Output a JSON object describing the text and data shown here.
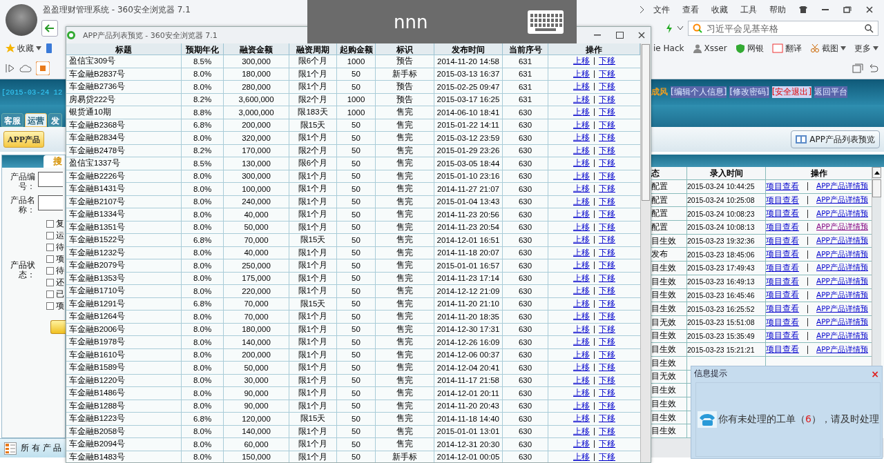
{
  "browser": {
    "title": "盈盈理财管理系统 - 360安全浏览器 7.1",
    "menu": [
      "文件",
      "查看",
      "收藏",
      "工具",
      "帮助"
    ],
    "search": {
      "placeholder": "习近平会见基辛格"
    },
    "bookmarks_left": [
      {
        "label": "收藏"
      }
    ],
    "bookmarks_right": [
      {
        "label": "ie Hack",
        "kind": "plain"
      },
      {
        "label": "Xsser",
        "kind": "person"
      },
      {
        "label": "网银",
        "kind": "shield"
      },
      {
        "label": "翻译",
        "kind": "translate"
      },
      {
        "label": "截图",
        "kind": "scissors"
      },
      {
        "label": "更多",
        "kind": "more"
      }
    ]
  },
  "overlay": {
    "text": "nnn"
  },
  "page": {
    "date": "[2015-03-24 12",
    "user_name": "成风",
    "user_links": [
      {
        "label": "[编辑个人信息]",
        "kind": "normal"
      },
      {
        "label": "[修改密码]",
        "kind": "normal"
      },
      {
        "label": "[安全退出]",
        "kind": "danger"
      },
      {
        "label": "返回平台",
        "kind": "plain"
      }
    ],
    "tabs": [
      {
        "label": "客服",
        "selected": false
      },
      {
        "label": "运营",
        "selected": true
      },
      {
        "label": "发",
        "selected": false
      }
    ],
    "product_button": "APP产品",
    "preview_button": "APP产品列表预览",
    "search_tab": "搜",
    "form": {
      "fields": [
        {
          "label": "产品编号："
        },
        {
          "label": "产品名称："
        }
      ],
      "status_label": "产品状态：",
      "options": [
        {
          "label": "复",
          "checked": false
        },
        {
          "label": "运",
          "checked": false
        },
        {
          "label": "待",
          "checked": false
        },
        {
          "label": "项",
          "checked": false
        },
        {
          "label": "待",
          "checked": false
        },
        {
          "label": "还",
          "checked": false
        },
        {
          "label": "已",
          "checked": false
        },
        {
          "label": "项",
          "checked": false
        }
      ]
    },
    "all_products": "所 有 产 品",
    "table": {
      "columns": [
        "态",
        "录入时间",
        "操作"
      ],
      "rows": [
        {
          "status": "配置",
          "time": "2015-03-24 10:44:25",
          "view": "项目查看",
          "preview": "APP产品详情预",
          "visited": false
        },
        {
          "status": "配置",
          "time": "2015-03-24 10:25:08",
          "view": "项目查看",
          "preview": "APP产品详情预",
          "visited": false
        },
        {
          "status": "配置",
          "time": "2015-03-24 10:08:23",
          "view": "项目查看",
          "preview": "APP产品详情预",
          "visited": false
        },
        {
          "status": "配置",
          "time": "2015-03-24 10:08:13",
          "view": "项目查看",
          "preview": "APP产品详情预",
          "visited": true
        },
        {
          "status": "目生效",
          "time": "2015-03-23 19:32:36",
          "view": "项目查看",
          "preview": "APP产品详情预",
          "visited": false
        },
        {
          "status": "发布",
          "time": "2015-03-23 18:45:06",
          "view": "项目查看",
          "preview": "APP产品详情预",
          "visited": false
        },
        {
          "status": "目生效",
          "time": "2015-03-23 17:49:43",
          "view": "项目查看",
          "preview": "APP产品详情预",
          "visited": false
        },
        {
          "status": "目生效",
          "time": "2015-03-23 16:49:13",
          "view": "项目查看",
          "preview": "APP产品详情预",
          "visited": false
        },
        {
          "status": "目生效",
          "time": "2015-03-23 16:45:46",
          "view": "项目查看",
          "preview": "APP产品详情预",
          "visited": false
        },
        {
          "status": "目生效",
          "time": "2015-03-23 16:25:52",
          "view": "项目查看",
          "preview": "APP产品详情预",
          "visited": false
        },
        {
          "status": "目无效",
          "time": "2015-03-23 15:51:08",
          "view": "项目查看",
          "preview": "APP产品详情预",
          "visited": false
        },
        {
          "status": "目生效",
          "time": "2015-03-23 15:35:49",
          "view": "项目查看",
          "preview": "APP产品详情预",
          "visited": false
        },
        {
          "status": "目生效",
          "time": "2015-03-23 15:21:21",
          "view": "项目查看",
          "preview": "APP产品详情预",
          "visited": false
        },
        {
          "status": "目生效"
        },
        {
          "status": "目无效"
        },
        {
          "status": "目生效"
        },
        {
          "status": "目生效"
        },
        {
          "status": "目生效"
        },
        {
          "status": "目生效"
        }
      ]
    }
  },
  "popup": {
    "title": "APP产品列表预览 - 360安全浏览器 7.1",
    "columns": [
      "标题",
      "预期年化",
      "融资金额",
      "融资周期",
      "起购金额",
      "标识",
      "发布时间",
      "当前序号",
      "操作"
    ],
    "rows": [
      {
        "cells": [
          "盈信宝309号",
          "8.5%",
          "300,000",
          "限6个月",
          "1000",
          "预告",
          "2014-11-20 14:58",
          "631"
        ],
        "actions": [
          "上移",
          "下移"
        ]
      },
      {
        "cells": [
          "车金融B2837号",
          "8.0%",
          "180,000",
          "限1个月",
          "50",
          "新手标",
          "2015-03-13 16:37",
          "631"
        ],
        "actions": [
          "上移",
          "下移"
        ]
      },
      {
        "cells": [
          "车金融B2736号",
          "8.0%",
          "280,000",
          "限1个月",
          "50",
          "预告",
          "2015-02-25 09:47",
          "631"
        ],
        "actions": [
          "上移",
          "下移"
        ]
      },
      {
        "cells": [
          "房易贷222号",
          "8.2%",
          "3,600,000",
          "限2个月",
          "1000",
          "预告",
          "2015-03-17 16:25",
          "631"
        ],
        "actions": [
          "上移",
          "下移"
        ]
      },
      {
        "cells": [
          "银货通10期",
          "8.8%",
          "3,000,000",
          "限183天",
          "1000",
          "售完",
          "2014-06-10 18:41",
          "630"
        ],
        "actions": [
          "上移",
          "下移"
        ]
      },
      {
        "cells": [
          "车金融B2368号",
          "6.8%",
          "200,000",
          "限15天",
          "50",
          "售完",
          "2015-01-22 14:11",
          "630"
        ],
        "actions": [
          "上移",
          "下移"
        ]
      },
      {
        "cells": [
          "车金融B2834号",
          "8.0%",
          "320,000",
          "限1个月",
          "50",
          "售完",
          "2015-03-12 23:59",
          "630"
        ],
        "actions": [
          "上移",
          "下移"
        ]
      },
      {
        "cells": [
          "车金融B2478号",
          "8.2%",
          "170,000",
          "限2个月",
          "50",
          "售完",
          "2015-01-29 23:26",
          "630"
        ],
        "actions": [
          "上移",
          "下移"
        ]
      },
      {
        "cells": [
          "盈信宝1337号",
          "8.5%",
          "130,000",
          "限6个月",
          "50",
          "售完",
          "2015-03-05 18:44",
          "630"
        ],
        "actions": [
          "上移",
          "下移"
        ]
      },
      {
        "cells": [
          "车金融B2226号",
          "8.0%",
          "300,000",
          "限1个月",
          "50",
          "售完",
          "2015-01-10 23:16",
          "630"
        ],
        "actions": [
          "上移",
          "下移"
        ]
      },
      {
        "cells": [
          "车金融B1431号",
          "8.0%",
          "100,000",
          "限1个月",
          "50",
          "售完",
          "2014-11-27 21:07",
          "630"
        ],
        "actions": [
          "上移",
          "下移"
        ]
      },
      {
        "cells": [
          "车金融B2107号",
          "8.0%",
          "240,000",
          "限1个月",
          "50",
          "售完",
          "2015-01-04 13:43",
          "630"
        ],
        "actions": [
          "上移",
          "下移"
        ]
      },
      {
        "cells": [
          "车金融B1334号",
          "8.0%",
          "40,000",
          "限1个月",
          "50",
          "售完",
          "2014-11-23 20:56",
          "630"
        ],
        "actions": [
          "上移",
          "下移"
        ]
      },
      {
        "cells": [
          "车金融B1351号",
          "8.0%",
          "50,000",
          "限1个月",
          "50",
          "售完",
          "2014-11-23 20:54",
          "630"
        ],
        "actions": [
          "上移",
          "下移"
        ]
      },
      {
        "cells": [
          "车金融B1522号",
          "6.8%",
          "70,000",
          "限15天",
          "50",
          "售完",
          "2014-12-01 16:51",
          "630"
        ],
        "actions": [
          "上移",
          "下移"
        ]
      },
      {
        "cells": [
          "车金融B1232号",
          "8.0%",
          "40,000",
          "限1个月",
          "50",
          "售完",
          "2014-11-18 20:07",
          "630"
        ],
        "actions": [
          "上移",
          "下移"
        ]
      },
      {
        "cells": [
          "车金融B2079号",
          "8.0%",
          "250,000",
          "限1个月",
          "50",
          "售完",
          "2015-01-01 16:57",
          "630"
        ],
        "actions": [
          "上移",
          "下移"
        ]
      },
      {
        "cells": [
          "车金融B1353号",
          "8.0%",
          "175,000",
          "限1个月",
          "50",
          "售完",
          "2014-11-23 17:14",
          "630"
        ],
        "actions": [
          "上移",
          "下移"
        ]
      },
      {
        "cells": [
          "车金融B1710号",
          "8.0%",
          "220,000",
          "限1个月",
          "50",
          "售完",
          "2014-12-12 21:09",
          "630"
        ],
        "actions": [
          "上移",
          "下移"
        ]
      },
      {
        "cells": [
          "车金融B1291号",
          "6.8%",
          "70,000",
          "限15天",
          "50",
          "售完",
          "2014-11-20 21:10",
          "630"
        ],
        "actions": [
          "上移",
          "下移"
        ]
      },
      {
        "cells": [
          "车金融B1264号",
          "8.0%",
          "70,000",
          "限1个月",
          "50",
          "售完",
          "2014-11-20 18:35",
          "630"
        ],
        "actions": [
          "上移",
          "下移"
        ]
      },
      {
        "cells": [
          "车金融B2006号",
          "8.0%",
          "180,000",
          "限1个月",
          "50",
          "售完",
          "2014-12-30 17:31",
          "630"
        ],
        "actions": [
          "上移",
          "下移"
        ]
      },
      {
        "cells": [
          "车金融B1978号",
          "8.0%",
          "140,000",
          "限1个月",
          "50",
          "售完",
          "2014-12-26 16:09",
          "630"
        ],
        "actions": [
          "上移",
          "下移"
        ]
      },
      {
        "cells": [
          "车金融B1610号",
          "8.0%",
          "200,000",
          "限1个月",
          "50",
          "售完",
          "2014-12-06 00:37",
          "630"
        ],
        "actions": [
          "上移",
          "下移"
        ]
      },
      {
        "cells": [
          "车金融B1589号",
          "8.0%",
          "50,000",
          "限1个月",
          "50",
          "售完",
          "2014-12-04 20:41",
          "630"
        ],
        "actions": [
          "上移",
          "下移"
        ]
      },
      {
        "cells": [
          "车金融B1220号",
          "8.0%",
          "30,000",
          "限1个月",
          "50",
          "售完",
          "2014-11-17 21:58",
          "630"
        ],
        "actions": [
          "上移",
          "下移"
        ]
      },
      {
        "cells": [
          "车金融B1486号",
          "8.0%",
          "90,000",
          "限1个月",
          "50",
          "售完",
          "2014-12-01 20:11",
          "630"
        ],
        "actions": [
          "上移",
          "下移"
        ]
      },
      {
        "cells": [
          "车金融B1288号",
          "8.0%",
          "90,000",
          "限1个月",
          "50",
          "售完",
          "2014-11-20 20:43",
          "630"
        ],
        "actions": [
          "上移",
          "下移"
        ]
      },
      {
        "cells": [
          "车金融B1223号",
          "6.8%",
          "120,000",
          "限15天",
          "50",
          "售完",
          "2014-11-18 14:40",
          "630"
        ],
        "actions": [
          "上移",
          "下移"
        ]
      },
      {
        "cells": [
          "车金融B2058号",
          "8.0%",
          "140,000",
          "限1个月",
          "50",
          "售完",
          "2015-01-01 13:01",
          "630"
        ],
        "actions": [
          "上移",
          "下移"
        ]
      },
      {
        "cells": [
          "车金融B2094号",
          "8.0%",
          "60,000",
          "限1个月",
          "50",
          "售完",
          "2014-12-31 20:30",
          "630"
        ],
        "actions": [
          "上移",
          "下移"
        ]
      },
      {
        "cells": [
          "车金融B1483号",
          "8.0%",
          "150,000",
          "限1个月",
          "50",
          "新手标",
          "2014-12-01 00:05",
          "630"
        ],
        "actions": [
          "上移",
          "下移"
        ]
      }
    ]
  },
  "notification": {
    "title": "信息提示",
    "close": "×",
    "message_before": "你有未处理的工单（",
    "count": "6",
    "message_after": "），请及时处理"
  }
}
